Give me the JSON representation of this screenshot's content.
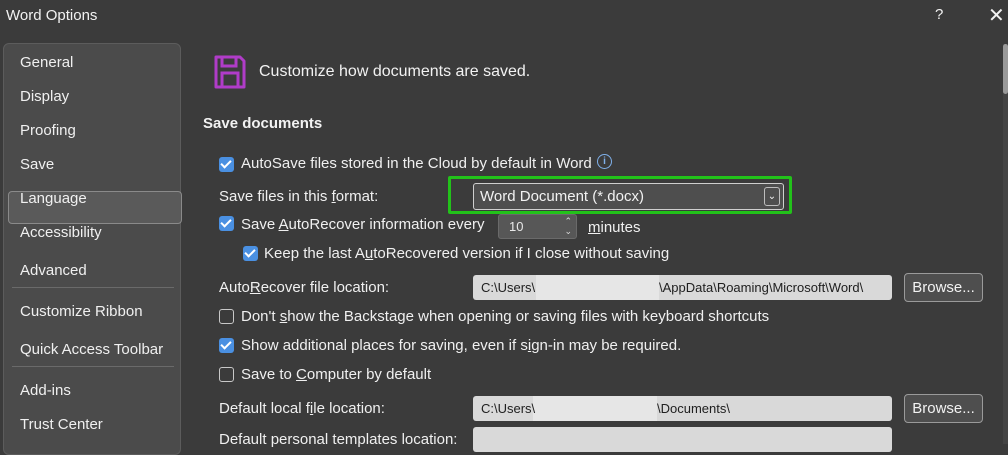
{
  "window": {
    "title": "Word Options",
    "help": "?",
    "close": "✕"
  },
  "sidebar": {
    "items": [
      {
        "label": "General"
      },
      {
        "label": "Display"
      },
      {
        "label": "Proofing"
      },
      {
        "label": "Save",
        "selected": true
      },
      {
        "label": "Language"
      },
      {
        "label": "Accessibility"
      },
      {
        "label": "Advanced"
      },
      {
        "label": "Customize Ribbon"
      },
      {
        "label": "Quick Access Toolbar"
      },
      {
        "label": "Add-ins"
      },
      {
        "label": "Trust Center"
      }
    ]
  },
  "header": {
    "icon": "save-disk-icon",
    "text": "Customize how documents are saved."
  },
  "section": {
    "title": "Save documents"
  },
  "options": {
    "autosave": {
      "label": "AutoSave files stored in the Cloud by default in Word",
      "checked": true,
      "info_icon": "info-icon"
    },
    "format": {
      "label_pre": "Save files in this ",
      "label_u": "f",
      "label_post": "ormat:",
      "value": "Word Document (*.docx)",
      "arrow": "chevron-down-icon"
    },
    "autorecover": {
      "label_pre": "Save ",
      "label_u": "A",
      "label_post": "utoRecover information every",
      "checked": true,
      "minutes_value": "10",
      "minutes_label_u": "m",
      "minutes_label_post": "inutes"
    },
    "keep_last": {
      "label_pre": "Keep the last A",
      "label_u": "u",
      "label_post": "toRecovered version if I close without saving",
      "checked": true
    },
    "autorecover_location": {
      "label_pre": "Auto",
      "label_u": "R",
      "label_post": "ecover file location:",
      "path_start": "C:\\Users\\",
      "path_end": "\\AppData\\Roaming\\Microsoft\\Word\\",
      "browse": "Browse..."
    },
    "backstage": {
      "label_pre": "Don't ",
      "label_u": "s",
      "label_post": "how the Backstage when opening or saving files with keyboard shortcuts",
      "checked": false
    },
    "additional_places": {
      "label_pre": "Show additional places for saving, even if s",
      "label_u": "i",
      "label_post": "gn-in may be required.",
      "checked": true
    },
    "save_to_computer": {
      "label_pre": "Save to ",
      "label_u": "C",
      "label_post": "omputer by default",
      "checked": false
    },
    "default_local": {
      "label_pre": "Default local f",
      "label_u": "i",
      "label_post": "le location:",
      "path_start": "C:\\Users\\",
      "path_end": "\\Documents\\",
      "browse": "Browse..."
    },
    "personal_templates": {
      "label": "Default personal templates location:"
    }
  },
  "colors": {
    "background": "#3b3b3b",
    "sidebar": "#4b4b4b",
    "accent": "#4a90e2",
    "highlight": "#22c21a",
    "icon_purple": "#b03cc8"
  }
}
